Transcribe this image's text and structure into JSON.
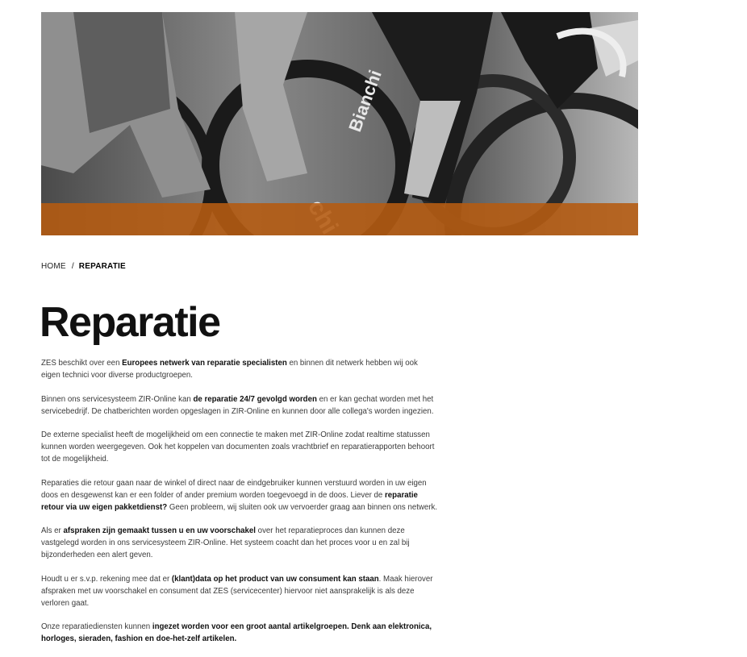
{
  "hero": {
    "image": "cyclists-bianchi-photo",
    "accent_color": "#d26a14"
  },
  "breadcrumb": {
    "home": "HOME",
    "separator": "/",
    "current": "REPARATIE"
  },
  "page": {
    "title": "Reparatie"
  },
  "paragraphs": [
    [
      {
        "t": "ZES beschikt over een "
      },
      {
        "t": "Europees netwerk van reparatie specialisten",
        "b": true
      },
      {
        "t": " en binnen dit netwerk hebben wij ook eigen technici voor diverse productgroepen."
      }
    ],
    [
      {
        "t": "Binnen ons servicesysteem ZIR-Online kan "
      },
      {
        "t": "de reparatie 24/7 gevolgd worden",
        "b": true
      },
      {
        "t": " en er kan gechat worden met het servicebedrijf. De chatberichten worden opgeslagen in ZIR-Online en kunnen door alle collega's worden ingezien."
      }
    ],
    [
      {
        "t": "De externe specialist heeft de mogelijkheid om een connectie te maken met ZIR-Online zodat realtime statussen kunnen worden weergegeven. Ook het koppelen van documenten zoals vrachtbrief en reparatierapporten behoort tot de mogelijkheid."
      }
    ],
    [
      {
        "t": "Reparaties die retour gaan naar de winkel of direct naar de eindgebruiker kunnen verstuurd worden in uw eigen doos en desgewenst kan er een folder of ander premium worden toegevoegd in de doos. Liever de "
      },
      {
        "t": "reparatie retour via uw eigen pakketdienst?",
        "b": true
      },
      {
        "t": " Geen probleem, wij sluiten ook uw vervoerder graag aan binnen ons netwerk."
      }
    ],
    [
      {
        "t": "Als er "
      },
      {
        "t": "afspraken zijn gemaakt tussen u en uw voorschakel",
        "b": true
      },
      {
        "t": " over het reparatieproces dan kunnen deze vastgelegd worden in ons servicesysteem ZIR-Online. Het systeem coacht dan het proces voor u en zal bij bijzonderheden een alert geven."
      }
    ],
    [
      {
        "t": "Houdt u er s.v.p. rekening mee dat er "
      },
      {
        "t": "(klant)data op het product van uw consument kan staan",
        "b": true
      },
      {
        "t": ". Maak hierover afspraken met uw voorschakel en consument dat ZES (servicecenter) hiervoor niet aansprakelijk is als deze verloren gaat."
      }
    ],
    [
      {
        "t": "Onze reparatiediensten kunnen "
      },
      {
        "t": "ingezet worden voor een groot aantal artikelgroepen. Denk aan elektronica, horloges, sieraden, fashion en doe-het-zelf artikelen.",
        "b": true
      }
    ]
  ]
}
